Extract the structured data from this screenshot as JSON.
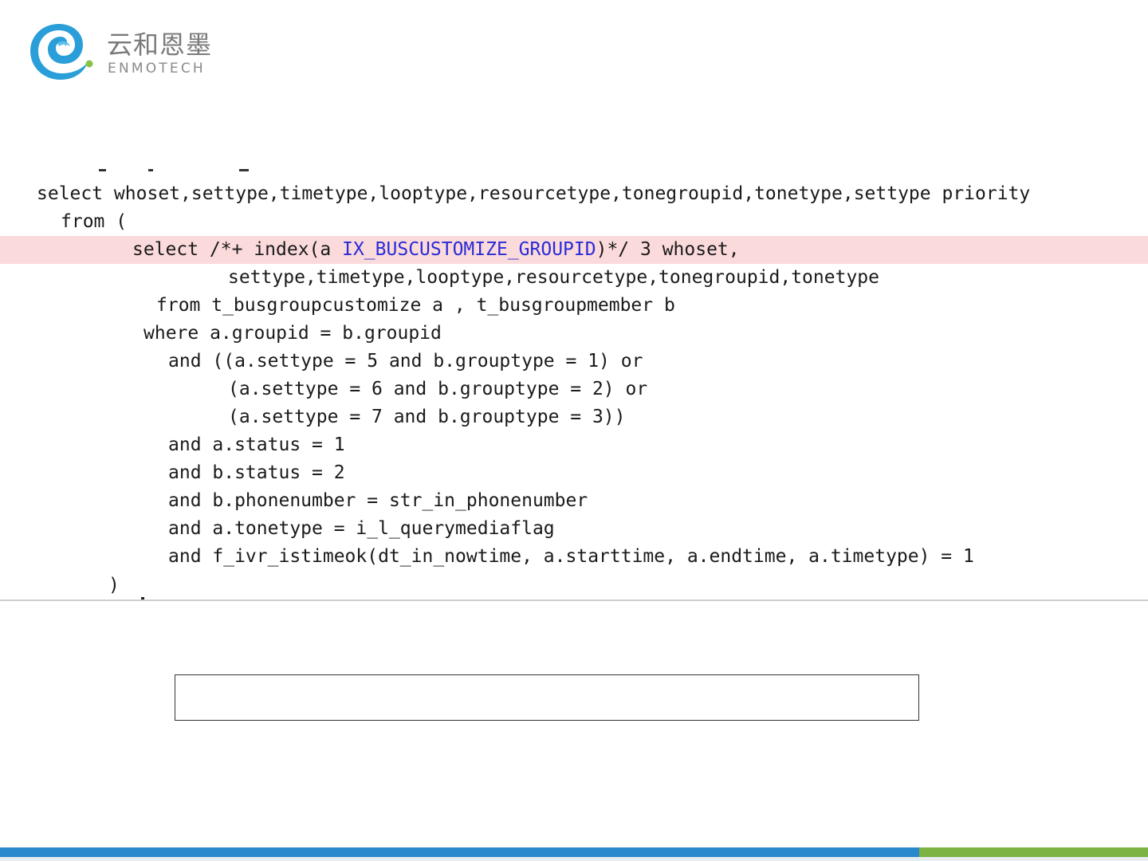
{
  "logo": {
    "name_cn": "云和恩墨",
    "name_en": "ENMOTECH",
    "colors": {
      "ring": "#2a9ed8",
      "dot": "#8ac249"
    }
  },
  "code": {
    "lines": [
      "select whoset,settype,timetype,looptype,resourcetype,tonegroupid,tonetype,settype priority",
      "from (",
      {
        "before": "select /*+ index(a ",
        "highlight": "IX_BUSCUSTOMIZE_GROUPID",
        "after": ")*/ 3 whoset,"
      },
      "settype,timetype,looptype,resourcetype,tonegroupid,tonetype",
      "from t_busgroupcustomize a , t_busgroupmember b",
      "where a.groupid = b.groupid",
      "and ((a.settype = 5 and b.grouptype = 1) or",
      "(a.settype = 6 and b.grouptype = 2) or",
      "(a.settype = 7 and b.grouptype = 3))",
      "and a.status = 1",
      "and b.status = 2",
      "and b.phonenumber = str_in_phonenumber",
      "and a.tonetype = i_l_querymediaflag",
      "and f_ivr_istimeok(dt_in_nowtime, a.starttime, a.endtime, a.timetype) = 1",
      ")"
    ],
    "highlight_line_bg": "#fbdadb",
    "hint_color": "#2b2bd8"
  },
  "text_box": {
    "value": ""
  },
  "footer": {
    "blue": "#2a88cc",
    "green": "#7cb342"
  }
}
